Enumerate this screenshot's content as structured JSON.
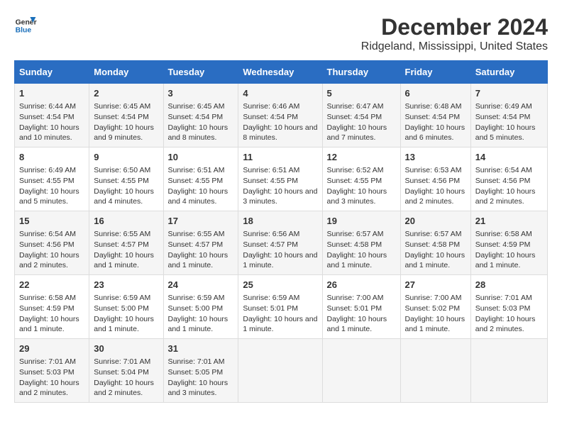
{
  "logo": {
    "line1": "General",
    "line2": "Blue"
  },
  "title": "December 2024",
  "subtitle": "Ridgeland, Mississippi, United States",
  "headers": [
    "Sunday",
    "Monday",
    "Tuesday",
    "Wednesday",
    "Thursday",
    "Friday",
    "Saturday"
  ],
  "weeks": [
    [
      {
        "day": "1",
        "sunrise": "6:44 AM",
        "sunset": "4:54 PM",
        "daylight": "10 hours and 10 minutes."
      },
      {
        "day": "2",
        "sunrise": "6:45 AM",
        "sunset": "4:54 PM",
        "daylight": "10 hours and 9 minutes."
      },
      {
        "day": "3",
        "sunrise": "6:45 AM",
        "sunset": "4:54 PM",
        "daylight": "10 hours and 8 minutes."
      },
      {
        "day": "4",
        "sunrise": "6:46 AM",
        "sunset": "4:54 PM",
        "daylight": "10 hours and 8 minutes."
      },
      {
        "day": "5",
        "sunrise": "6:47 AM",
        "sunset": "4:54 PM",
        "daylight": "10 hours and 7 minutes."
      },
      {
        "day": "6",
        "sunrise": "6:48 AM",
        "sunset": "4:54 PM",
        "daylight": "10 hours and 6 minutes."
      },
      {
        "day": "7",
        "sunrise": "6:49 AM",
        "sunset": "4:54 PM",
        "daylight": "10 hours and 5 minutes."
      }
    ],
    [
      {
        "day": "8",
        "sunrise": "6:49 AM",
        "sunset": "4:55 PM",
        "daylight": "10 hours and 5 minutes."
      },
      {
        "day": "9",
        "sunrise": "6:50 AM",
        "sunset": "4:55 PM",
        "daylight": "10 hours and 4 minutes."
      },
      {
        "day": "10",
        "sunrise": "6:51 AM",
        "sunset": "4:55 PM",
        "daylight": "10 hours and 4 minutes."
      },
      {
        "day": "11",
        "sunrise": "6:51 AM",
        "sunset": "4:55 PM",
        "daylight": "10 hours and 3 minutes."
      },
      {
        "day": "12",
        "sunrise": "6:52 AM",
        "sunset": "4:55 PM",
        "daylight": "10 hours and 3 minutes."
      },
      {
        "day": "13",
        "sunrise": "6:53 AM",
        "sunset": "4:56 PM",
        "daylight": "10 hours and 2 minutes."
      },
      {
        "day": "14",
        "sunrise": "6:54 AM",
        "sunset": "4:56 PM",
        "daylight": "10 hours and 2 minutes."
      }
    ],
    [
      {
        "day": "15",
        "sunrise": "6:54 AM",
        "sunset": "4:56 PM",
        "daylight": "10 hours and 2 minutes."
      },
      {
        "day": "16",
        "sunrise": "6:55 AM",
        "sunset": "4:57 PM",
        "daylight": "10 hours and 1 minute."
      },
      {
        "day": "17",
        "sunrise": "6:55 AM",
        "sunset": "4:57 PM",
        "daylight": "10 hours and 1 minute."
      },
      {
        "day": "18",
        "sunrise": "6:56 AM",
        "sunset": "4:57 PM",
        "daylight": "10 hours and 1 minute."
      },
      {
        "day": "19",
        "sunrise": "6:57 AM",
        "sunset": "4:58 PM",
        "daylight": "10 hours and 1 minute."
      },
      {
        "day": "20",
        "sunrise": "6:57 AM",
        "sunset": "4:58 PM",
        "daylight": "10 hours and 1 minute."
      },
      {
        "day": "21",
        "sunrise": "6:58 AM",
        "sunset": "4:59 PM",
        "daylight": "10 hours and 1 minute."
      }
    ],
    [
      {
        "day": "22",
        "sunrise": "6:58 AM",
        "sunset": "4:59 PM",
        "daylight": "10 hours and 1 minute."
      },
      {
        "day": "23",
        "sunrise": "6:59 AM",
        "sunset": "5:00 PM",
        "daylight": "10 hours and 1 minute."
      },
      {
        "day": "24",
        "sunrise": "6:59 AM",
        "sunset": "5:00 PM",
        "daylight": "10 hours and 1 minute."
      },
      {
        "day": "25",
        "sunrise": "6:59 AM",
        "sunset": "5:01 PM",
        "daylight": "10 hours and 1 minute."
      },
      {
        "day": "26",
        "sunrise": "7:00 AM",
        "sunset": "5:01 PM",
        "daylight": "10 hours and 1 minute."
      },
      {
        "day": "27",
        "sunrise": "7:00 AM",
        "sunset": "5:02 PM",
        "daylight": "10 hours and 1 minute."
      },
      {
        "day": "28",
        "sunrise": "7:01 AM",
        "sunset": "5:03 PM",
        "daylight": "10 hours and 2 minutes."
      }
    ],
    [
      {
        "day": "29",
        "sunrise": "7:01 AM",
        "sunset": "5:03 PM",
        "daylight": "10 hours and 2 minutes."
      },
      {
        "day": "30",
        "sunrise": "7:01 AM",
        "sunset": "5:04 PM",
        "daylight": "10 hours and 2 minutes."
      },
      {
        "day": "31",
        "sunrise": "7:01 AM",
        "sunset": "5:05 PM",
        "daylight": "10 hours and 3 minutes."
      },
      null,
      null,
      null,
      null
    ]
  ]
}
